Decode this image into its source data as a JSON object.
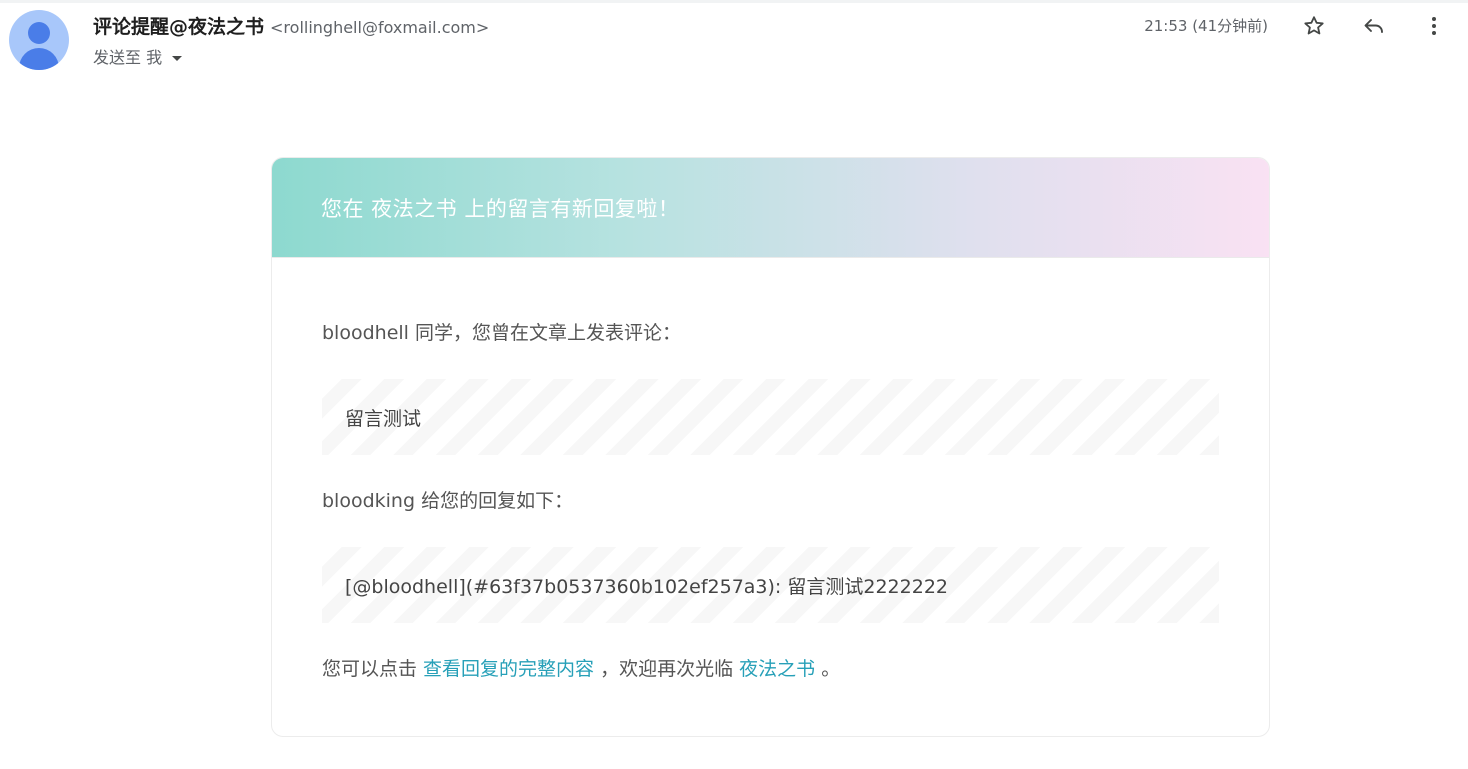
{
  "message": {
    "sender_name": "评论提醒@夜法之书",
    "sender_email": "<rollinghell@foxmail.com>",
    "to_label": "发送至 我",
    "time": "21:53 (41分钟前)"
  },
  "actions": {
    "star_icon": "star-icon",
    "reply_icon": "reply-icon",
    "more_icon": "more-vertical-icon"
  },
  "card": {
    "header_title": "您在 夜法之书 上的留言有新回复啦！",
    "intro": "bloodhell 同学，您曾在文章上发表评论：",
    "original_comment": "留言测试",
    "reply_intro": "bloodking 给您的回复如下：",
    "reply_content": "[@bloodhell](#63f37b0537360b102ef257a3): 留言测试2222222",
    "footer_prefix": "您可以点击 ",
    "footer_link": "查看回复的完整内容",
    "footer_middle": " ，欢迎再次光临 ",
    "footer_site_link": "夜法之书",
    "footer_suffix": " 。"
  },
  "colors": {
    "link": "#27a0b8",
    "header_gradient_start": "#8dd9cf",
    "header_gradient_end": "#f9e1f3",
    "avatar_bg": "#a8c7fa",
    "avatar_fg": "#4a7de8"
  }
}
